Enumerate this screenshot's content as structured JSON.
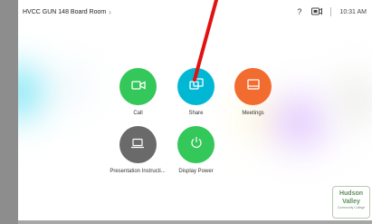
{
  "header": {
    "room_name": "HVCC GUN 148 Board Room",
    "help_label": "?",
    "time": "10:31 AM"
  },
  "tiles": [
    {
      "label": "Call",
      "color": "#34c759",
      "icon": "camera-icon"
    },
    {
      "label": "Share",
      "color": "#00b8d4",
      "icon": "share-screen-icon"
    },
    {
      "label": "Meetings",
      "color": "#f26b2f",
      "icon": "calendar-icon"
    },
    {
      "label": "Presentation Instructi...",
      "color": "#6a6a6a",
      "icon": "laptop-icon"
    },
    {
      "label": "Display Power",
      "color": "#34c759",
      "icon": "power-icon"
    }
  ],
  "logo": {
    "line1": "Hudson",
    "line2": "Valley",
    "line3": "Community College"
  },
  "colors": {
    "pointer": "#e01212"
  }
}
